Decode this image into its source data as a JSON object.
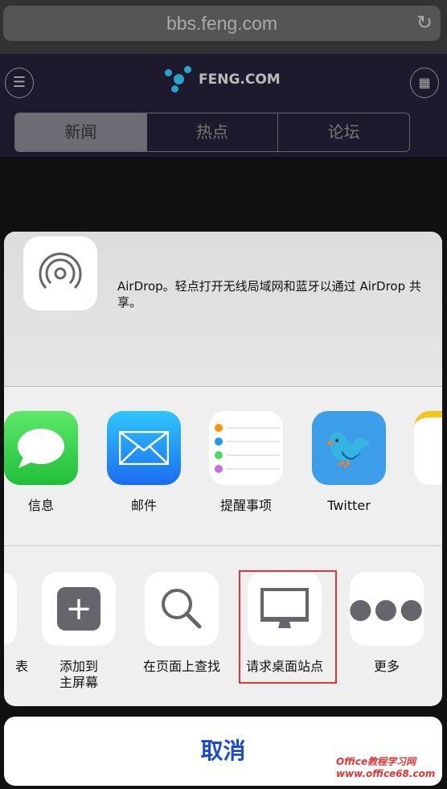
{
  "browser": {
    "url": "bbs.feng.com",
    "reload_icon": "reload-icon"
  },
  "site": {
    "logo_text": "FENG.COM",
    "tabs": [
      "新闻",
      "热点",
      "论坛"
    ]
  },
  "airdrop": {
    "text": "AirDrop。轻点打开无线局域网和蓝牙以通过 AirDrop 共享。"
  },
  "apps": [
    {
      "label": "信息",
      "color": "#2fc845"
    },
    {
      "label": "邮件",
      "color": "#1e8ef5"
    },
    {
      "label": "提醒事项",
      "color": "#ffffff"
    },
    {
      "label": "Twitter",
      "color": "#3c9ee8"
    }
  ],
  "actions": [
    {
      "label": "表"
    },
    {
      "label": "添加到\n主屏幕"
    },
    {
      "label": "在页面上查找"
    },
    {
      "label": "请求桌面站点"
    },
    {
      "label": "更多"
    }
  ],
  "cancel_label": "取消",
  "highlight_color": "#e23636",
  "watermark": "Office教程学习网 www.office68.com"
}
